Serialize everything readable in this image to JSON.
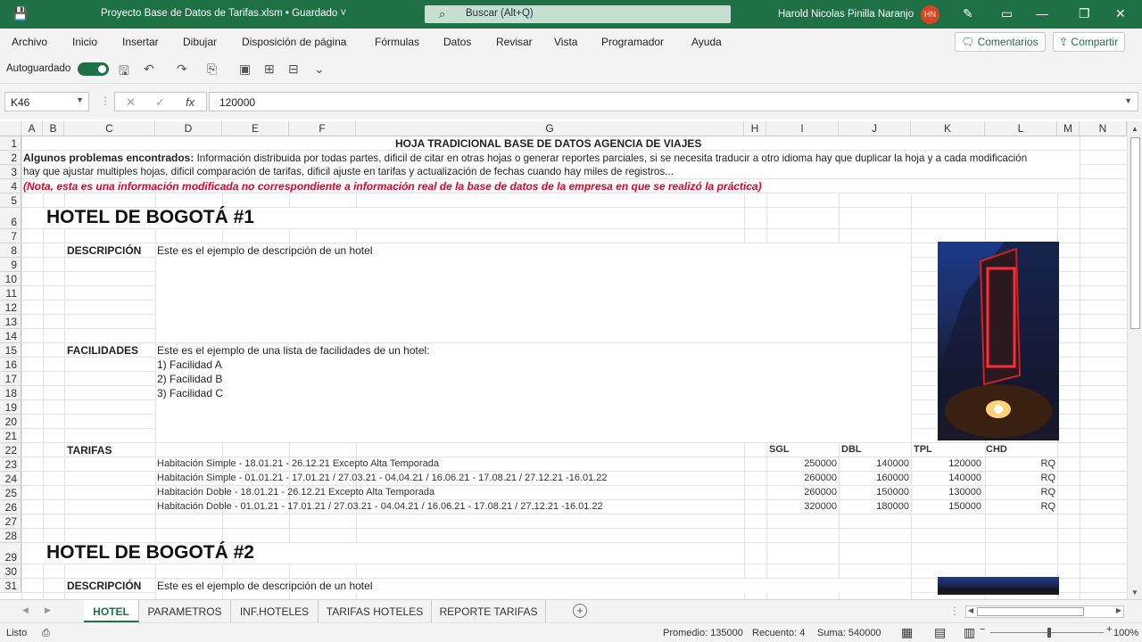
{
  "titlebar": {
    "doc_title": "Proyecto Base de Datos de Tarifas.xlsm • Guardado",
    "doc_title_caret": "˅",
    "search_placeholder": "Buscar (Alt+Q)",
    "user_name": "Harold Nicolas Pinilla Naranjo",
    "avatar_initials": "HN"
  },
  "menu": {
    "items": [
      "Archivo",
      "Inicio",
      "Insertar",
      "Dibujar",
      "Disposición de página",
      "Fórmulas",
      "Datos",
      "Revisar",
      "Vista",
      "Programador",
      "Ayuda"
    ],
    "comments": "Comentarios",
    "share": "Compartir"
  },
  "qat": {
    "autosave_label": "Autoguardado"
  },
  "formula_bar": {
    "name_box": "K46",
    "formula": "120000",
    "fx": "fx"
  },
  "columns": [
    "A",
    "B",
    "C",
    "D",
    "E",
    "F",
    "G",
    "H",
    "I",
    "J",
    "K",
    "L",
    "M",
    "N"
  ],
  "rows": [
    "1",
    "2",
    "3",
    "4",
    "5",
    "6",
    "7",
    "8",
    "9",
    "10",
    "11",
    "12",
    "13",
    "14",
    "15",
    "16",
    "17",
    "18",
    "19",
    "20",
    "21",
    "22",
    "23",
    "24",
    "25",
    "26",
    "27",
    "28",
    "29",
    "30",
    "31"
  ],
  "sheet": {
    "title": "HOJA TRADICIONAL BASE DE DATOS AGENCIA DE VIAJES",
    "problems_label": "Algunos problemas encontrados:",
    "problems_text1": " Información distribuida por todas partes, dificil de citar en otras hojas o generar reportes parciales, si se necesita traducir a otro idioma hay que duplicar la hoja y a cada modificación",
    "problems_text2": "hay que ajustar multiples hojas, dificil comparación de tarifas, dificil ajuste en tarifas y actualización de fechas cuando hay miles de registros...",
    "note": "(Nota, esta es una información modificada no correspondiente a información real de la base de datos de la empresa en que se realizó la práctica)",
    "hotel1": {
      "name": "HOTEL DE BOGOTÁ #1",
      "desc_label": "DESCRIPCIÓN",
      "desc_text": "Este es el ejemplo de descripción de un hotel",
      "fac_label": "FACILIDADES",
      "fac_intro": "Este es el ejemplo de una lista de facilidades de un hotel:",
      "facilities": [
        "1) Facilidad A",
        "2) Facilidad B",
        "3) Facilidad C"
      ],
      "rates_label": "TARIFAS",
      "rate_headers": [
        "SGL",
        "DBL",
        "TPL",
        "CHD"
      ],
      "rates": [
        {
          "desc": "Habitación Simple - 18.01.21 - 26.12.21 Excepto Alta Temporada",
          "sgl": "250000",
          "dbl": "140000",
          "tpl": "120000",
          "chd": "RQ"
        },
        {
          "desc": "Habitación Simple - 01.01.21 - 17.01.21 / 27.03.21 - 04.04.21 / 16.06.21 - 17.08.21 / 27.12.21 -16.01.22",
          "sgl": "260000",
          "dbl": "160000",
          "tpl": "140000",
          "chd": "RQ"
        },
        {
          "desc": "Habitación Doble - 18.01.21 - 26.12.21 Excepto Alta Temporada",
          "sgl": "260000",
          "dbl": "150000",
          "tpl": "130000",
          "chd": "RQ"
        },
        {
          "desc": "Habitación Doble - 01.01.21 - 17.01.21 / 27.03.21 - 04.04.21 / 16.06.21 - 17.08.21 / 27.12.21 -16.01.22",
          "sgl": "320000",
          "dbl": "180000",
          "tpl": "150000",
          "chd": "RQ"
        }
      ]
    },
    "hotel2": {
      "name": "HOTEL DE BOGOTÁ #2",
      "desc_label": "DESCRIPCIÓN",
      "desc_text": "Este es el ejemplo de descripción de un hotel"
    }
  },
  "tabs": [
    "HOTEL",
    "PARAMETROS",
    "INF.HOTELES",
    "TARIFAS HOTELES",
    "REPORTE TARIFAS"
  ],
  "status": {
    "ready": "Listo",
    "average": "Promedio: 135000",
    "count": "Recuento: 4",
    "sum": "Suma: 540000",
    "zoom": "100%"
  },
  "colors": {
    "excel_green": "#1e7145",
    "note_red": "#e0002a"
  }
}
